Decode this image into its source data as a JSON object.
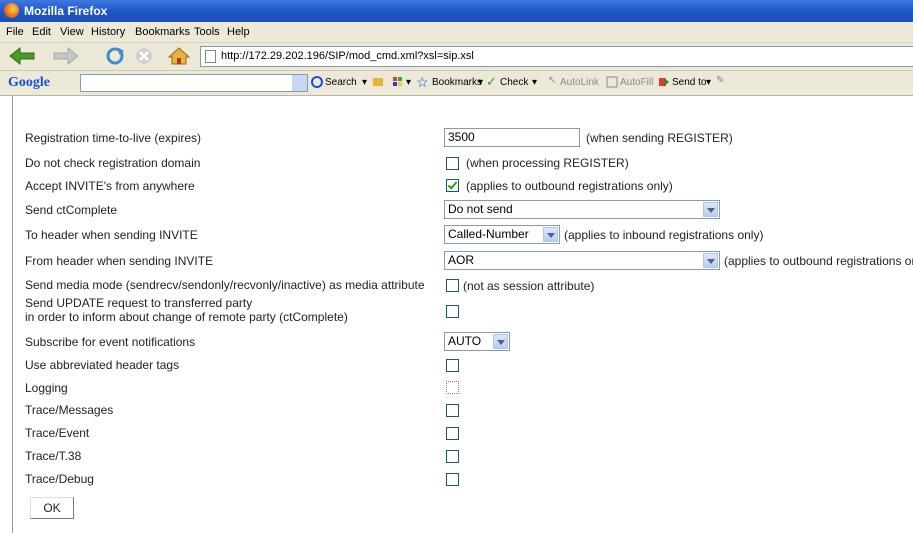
{
  "window": {
    "title": "Mozilla Firefox"
  },
  "menu": [
    "File",
    "Edit",
    "View",
    "History",
    "Bookmarks",
    "Tools",
    "Help"
  ],
  "nav": {
    "url": "http://172.29.202.196/SIP/mod_cmd.xml?xsl=sip.xsl"
  },
  "googlebar": {
    "logo": "Google",
    "search": "Search",
    "bookmarks": "Bookmarks",
    "check": "Check",
    "autolink": "AutoLink",
    "autofill": "AutoFill",
    "sendto": "Send to"
  },
  "form": {
    "rows": [
      {
        "label": "Registration time-to-live (expires)",
        "value": "3500",
        "note": "(when sending REGISTER)"
      },
      {
        "label": "Do not check registration domain",
        "checked": false,
        "note": "(when processing REGISTER)"
      },
      {
        "label": "Accept INVITE's from anywhere",
        "checked": true,
        "note": "(applies to outbound registrations only)"
      },
      {
        "label": "Send ctComplete",
        "selected": "Do not send"
      },
      {
        "label": "To header when sending INVITE",
        "selected": "Called-Number",
        "note": "(applies to inbound registrations only)"
      },
      {
        "label": "From header when sending INVITE",
        "selected": "AOR",
        "note": "(applies to outbound registrations only)"
      },
      {
        "label": "Send media mode (sendrecv/sendonly/recvonly/inactive) as media attribute",
        "checked": false,
        "note": "(not as session attribute)"
      },
      {
        "label": "Send UPDATE request to transferred party",
        "label2": "in order to inform about change of remote party (ctComplete)",
        "checked": false
      },
      {
        "label": "Subscribe for event notifications",
        "selected": "AUTO"
      },
      {
        "label": "Use abbreviated header tags",
        "checked": false
      },
      {
        "label": "Logging",
        "checked": false
      },
      {
        "label": "Trace/Messages",
        "checked": false
      },
      {
        "label": "Trace/Event",
        "checked": false
      },
      {
        "label": "Trace/T.38",
        "checked": false
      },
      {
        "label": "Trace/Debug",
        "checked": false
      }
    ],
    "ok_label": "OK"
  }
}
